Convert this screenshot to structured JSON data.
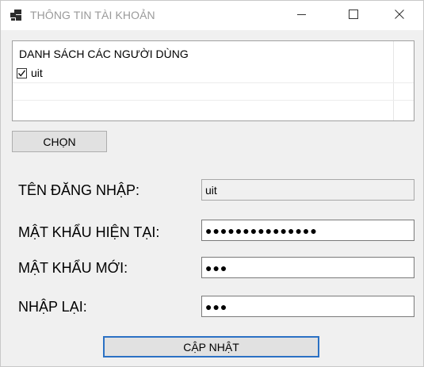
{
  "window": {
    "title": "THÔNG TIN TÀI KHOẢN",
    "icon": "app-window-icon"
  },
  "user_list": {
    "header": "DANH SÁCH CÁC NGƯỜI DÙNG",
    "items": [
      {
        "label": "uit",
        "checked": true
      }
    ]
  },
  "buttons": {
    "select_label": "CHỌN",
    "update_label": "CẬP NHẬT"
  },
  "form": {
    "username_label": "TÊN ĐĂNG NHẬP:",
    "username_value": "uit",
    "current_password_label": "MẬT KHẨU HIỆN TẠI:",
    "current_password_value": "●●●●●●●●●●●●●●●",
    "new_password_label": "MẬT KHẨU MỚI:",
    "new_password_value": "●●●",
    "confirm_password_label": "NHẬP LẠI:",
    "confirm_password_value": "●●●"
  },
  "colors": {
    "accent_border": "#2b71c4",
    "title_text": "#9a9a9a",
    "window_bg": "#f0f0f0"
  }
}
